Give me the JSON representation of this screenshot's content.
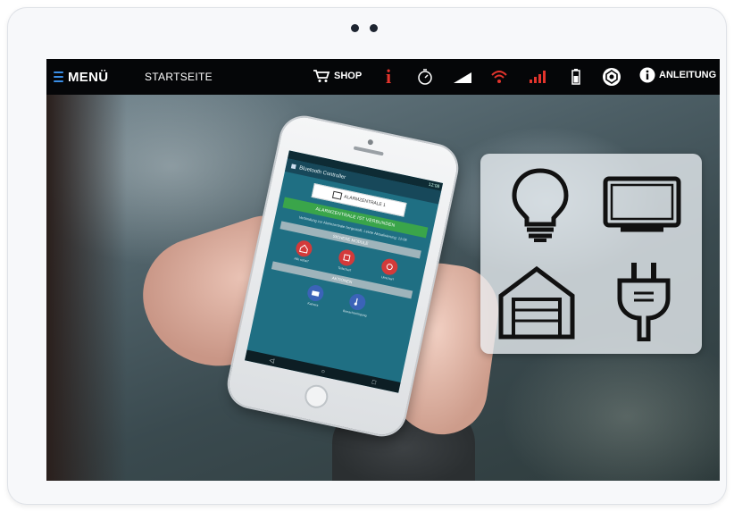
{
  "tablet": {
    "colors": {
      "frame": "#f7f8fa",
      "topbar": "#050608",
      "accent_blue": "#3a8ee6",
      "accent_red": "#e2342c"
    }
  },
  "topbar": {
    "menu_label": "MENÜ",
    "startseite_label": "STARTSEITE",
    "shop_label": "SHOP",
    "info_glyph": "i",
    "anleitung_label": "ANLEITUNG",
    "icons": [
      "hamburger-icon",
      "cart-icon",
      "info-icon",
      "timer-icon",
      "signal-icon",
      "wifi-icon",
      "signal-bars-icon",
      "battery-icon",
      "settings-icon",
      "info-circle-icon"
    ]
  },
  "phone_app": {
    "status_time": "12:08",
    "title": "Bluetooth Controller",
    "banner_label": "ALARMZENTRALE 1",
    "green_status": "ALARMZENTRALE IST VERBUNDEN",
    "small_text": "Verbindung zur Alarmzentrale hergestellt. Letzte Aktualisierung: 12:08",
    "section_1": "SICHERE MODULE",
    "section_2": "AKTIONEN",
    "buttons_row1": [
      "Alle scharf",
      "Teilscharf",
      "Unscharf"
    ],
    "buttons_row2": [
      "Kamera",
      "Benachrichtigung"
    ],
    "nav_glyphs": [
      "◁",
      "○",
      "□"
    ]
  },
  "device_panel": {
    "icons": [
      "lightbulb-icon",
      "tv-icon",
      "garage-icon",
      "plug-icon"
    ]
  }
}
